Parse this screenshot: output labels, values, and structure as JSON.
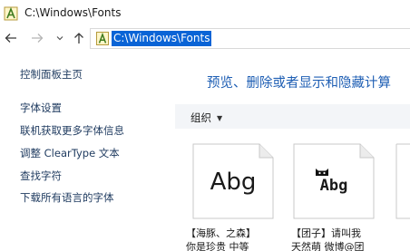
{
  "window": {
    "title": "C:\\Windows\\Fonts"
  },
  "address_bar": {
    "path": "C:\\Windows\\Fonts"
  },
  "nav": {
    "back_icon": "arrow-left-icon",
    "forward_icon": "arrow-right-icon",
    "recent_icon": "chevron-down-icon",
    "up_icon": "arrow-up-icon"
  },
  "sidebar": {
    "items": [
      {
        "label": "控制面板主页"
      },
      {
        "label": "字体设置"
      },
      {
        "label": "联机获取更多字体信息"
      },
      {
        "label": "调整 ClearType 文本"
      },
      {
        "label": "查找字符"
      },
      {
        "label": "下载所有语言的字体"
      }
    ]
  },
  "main": {
    "heading": "预览、删除或者显示和隐藏计算",
    "toolbar": {
      "organize_label": "组织"
    },
    "fonts": [
      {
        "preview": "Abg",
        "name_line1": "【海豚、之森】",
        "name_line2": "你是珍贵 中等"
      },
      {
        "preview": "Abg",
        "name_line1": "【团子】请叫我",
        "name_line2": "天然萌 微博@团"
      }
    ]
  },
  "colors": {
    "accent": "#0a64d6",
    "link": "#1e3a5f",
    "heading": "#1f5fb4"
  }
}
